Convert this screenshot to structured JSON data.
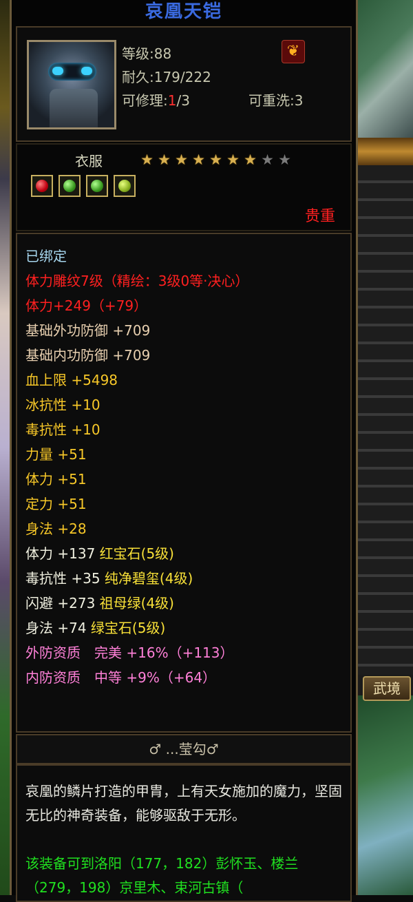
{
  "item": {
    "title": "哀凰天铠",
    "level_label": "等级:88",
    "durability_label": "耐久:179/222",
    "repair_prefix": "可修理:",
    "repair_current": "1",
    "repair_suffix": "/3",
    "rewash_label": "可重洗:3",
    "type_label": "衣服",
    "stars_total": 9,
    "stars_filled": 7,
    "precious_label": "贵重",
    "gem_slots": [
      "red",
      "green",
      "green",
      "yellow"
    ]
  },
  "stats": [
    {
      "text": "已绑定",
      "color": "bound"
    },
    {
      "text": "体力雕纹7级（精绘：3级0等·决心）",
      "color": "red"
    },
    {
      "text": "体力+249（+79）",
      "color": "red"
    },
    {
      "text": "基础外功防御 +709",
      "color": "base"
    },
    {
      "text": "基础内功防御 +709",
      "color": "base"
    },
    {
      "text": "血上限 +5498",
      "color": "yellow"
    },
    {
      "text": "冰抗性 +10",
      "color": "yellow"
    },
    {
      "text": "毒抗性 +10",
      "color": "yellow"
    },
    {
      "text": "力量 +51",
      "color": "yellow"
    },
    {
      "text": "体力 +51",
      "color": "yellow"
    },
    {
      "text": "定力 +51",
      "color": "yellow"
    },
    {
      "text": "身法 +28",
      "color": "yellow"
    }
  ],
  "gem_stats": [
    {
      "stat": "体力 +137",
      "gem": "红宝石(5级)"
    },
    {
      "stat": "毒抗性 +35",
      "gem": "纯净碧玺(4级)"
    },
    {
      "stat": "闪避 +273",
      "gem": "祖母绿(4级)"
    },
    {
      "stat": "身法 +74",
      "gem": "绿宝石(5级)"
    }
  ],
  "quality": [
    {
      "text": "外防资质　完美 +16%（+113）"
    },
    {
      "text": "内防资质　中等 +9%（+64）"
    }
  ],
  "crafter_label": "♂ ...莹勾♂",
  "description": "哀凰的鳞片打造的甲胄，上有天女施加的魔力，坚固无比的神奇装备，能够驱敌于无形。",
  "location_text": "该装备可到洛阳（177，182）彭怀玉、楼兰（279，198）京里木、束河古镇（",
  "side_tab_label": "武境",
  "colors": {
    "title": "#3a6ae0",
    "red": "#ff2020",
    "yellow": "#f8c828",
    "pink": "#ff80d8",
    "green": "#20e020",
    "bound": "#a8d8f0"
  }
}
